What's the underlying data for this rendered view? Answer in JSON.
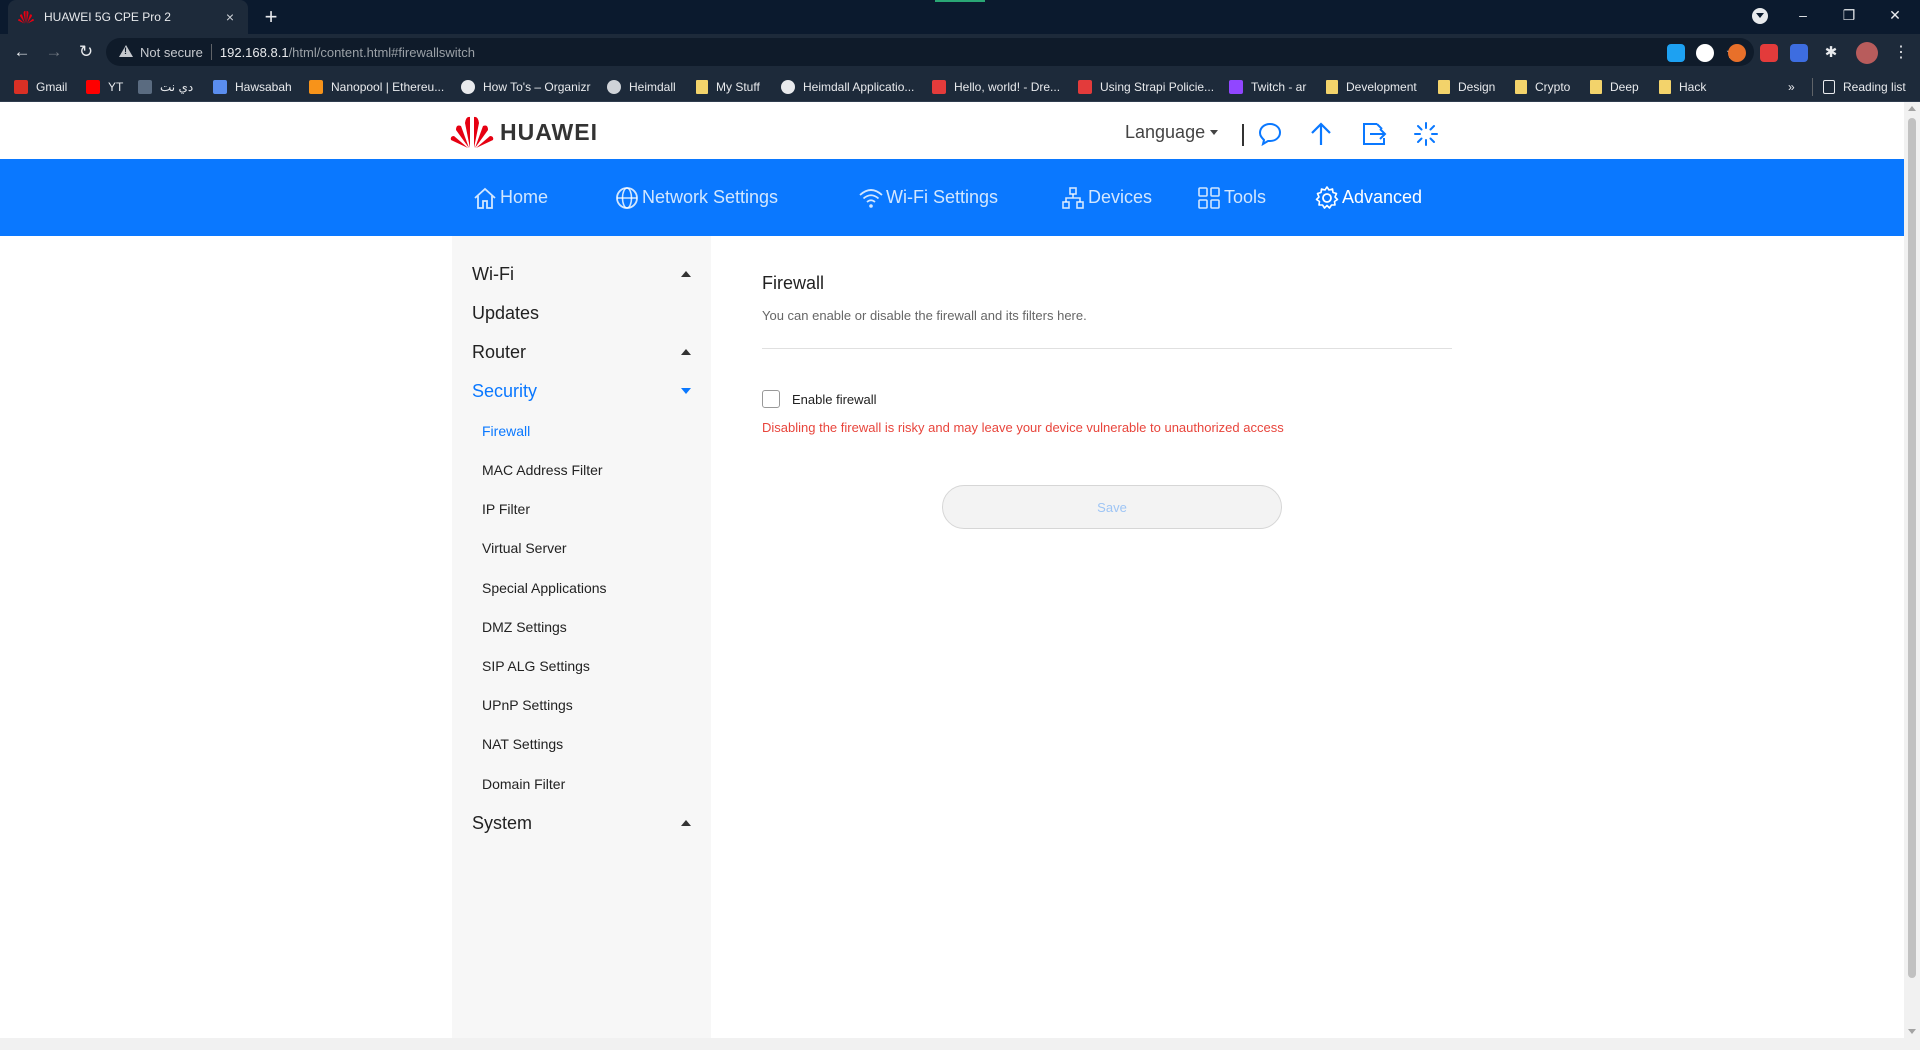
{
  "browser": {
    "tab_title": "HUAWEI 5G CPE Pro 2",
    "tab_close": "×",
    "new_tab": "+",
    "url": {
      "warning_text": "Not secure",
      "host": "192.168.8.1",
      "path": "/html/content.html#firewallswitch"
    },
    "window_controls": {
      "minimize": "–",
      "restore": "❐",
      "close": "✕"
    },
    "bookmarks": [
      {
        "label": "Gmail",
        "icon": "gmail-icon",
        "color": "#d93025"
      },
      {
        "label": "YT",
        "icon": "youtube-icon",
        "color": "#ff0000"
      },
      {
        "label": "دي نت",
        "icon": "dnet-icon",
        "color": "#ffffff"
      },
      {
        "label": "Hawsabah",
        "icon": "hawsabah-icon",
        "color": "#5a8dee"
      },
      {
        "label": "Nanopool | Ethereu...",
        "icon": "nanopool-icon",
        "color": "#f7931a"
      },
      {
        "label": "How To's – Organizr",
        "icon": "organizr-icon",
        "color": "#e8eaed"
      },
      {
        "label": "Heimdall",
        "icon": "heimdall-icon",
        "color": "#cfd3d8"
      },
      {
        "label": "My Stuff",
        "icon": "folder-icon",
        "color": "#f3d36b"
      },
      {
        "label": "Heimdall Applicatio...",
        "icon": "heimdall-app-icon",
        "color": "#e8eaed"
      },
      {
        "label": "Hello, world! - Dre...",
        "icon": "dreamhost-icon",
        "color": "#e33b3b"
      },
      {
        "label": "Using Strapi Policie...",
        "icon": "strapi-icon",
        "color": "#e33b3b"
      },
      {
        "label": "Twitch - ar",
        "icon": "twitch-icon",
        "color": "#9146ff"
      },
      {
        "label": "Development",
        "icon": "folder-icon",
        "color": "#f3d36b"
      },
      {
        "label": "Design",
        "icon": "folder-icon",
        "color": "#f3d36b"
      },
      {
        "label": "Crypto",
        "icon": "folder-icon",
        "color": "#f3d36b"
      },
      {
        "label": "Deep",
        "icon": "folder-icon",
        "color": "#f3d36b"
      },
      {
        "label": "Hack",
        "icon": "folder-icon",
        "color": "#f3d36b"
      }
    ],
    "bookmarks_overflow": "»",
    "reading_list": "Reading list"
  },
  "header": {
    "brand": "HUAWEI",
    "language_label": "Language",
    "brand_color": "#e60012"
  },
  "nav": {
    "accent_color": "#0a78ff",
    "items": [
      {
        "label": "Home",
        "icon": "home-icon"
      },
      {
        "label": "Network Settings",
        "icon": "globe-icon"
      },
      {
        "label": "Wi-Fi Settings",
        "icon": "wifi-icon"
      },
      {
        "label": "Devices",
        "icon": "devices-icon"
      },
      {
        "label": "Tools",
        "icon": "tools-icon"
      },
      {
        "label": "Advanced",
        "icon": "gear-icon",
        "active": true
      }
    ]
  },
  "sidebar": {
    "sections": [
      {
        "label": "Wi-Fi",
        "expanded": false
      },
      {
        "label": "Updates"
      },
      {
        "label": "Router",
        "expanded": false
      },
      {
        "label": "Security",
        "expanded": true,
        "active": true
      },
      {
        "label": "System",
        "expanded": false
      }
    ],
    "security_items": [
      "Firewall",
      "MAC Address Filter",
      "IP Filter",
      "Virtual Server",
      "Special Applications",
      "DMZ Settings",
      "SIP ALG Settings",
      "UPnP Settings",
      "NAT Settings",
      "Domain Filter"
    ],
    "active_item": "Firewall"
  },
  "firewall": {
    "title": "Firewall",
    "description": "You can enable or disable the firewall and its filters here.",
    "checkbox_label": "Enable firewall",
    "checkbox_checked": false,
    "warning": "Disabling the firewall is risky and may leave your device vulnerable to unauthorized access",
    "warning_color": "#e8453c",
    "save_label": "Save"
  }
}
